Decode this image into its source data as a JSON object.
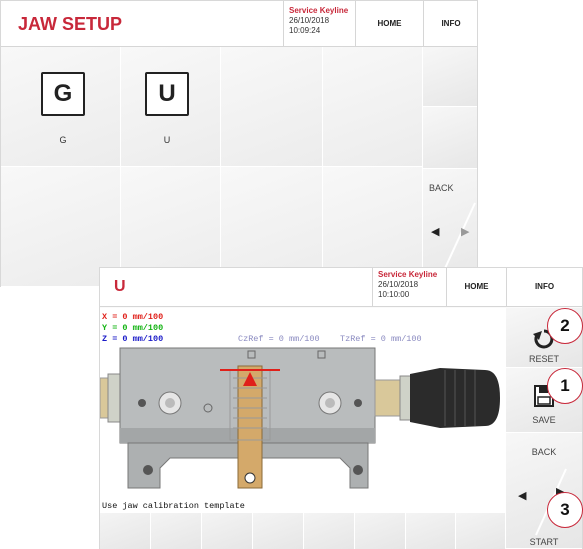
{
  "screen1": {
    "title": "JAW SETUP",
    "service": {
      "name": "Service Keyline",
      "date": "26/10/2018",
      "time": "10:09:24"
    },
    "home": "HOME",
    "info": "INFO",
    "jaws": [
      {
        "letter": "G",
        "label": "G"
      },
      {
        "letter": "U",
        "label": "U"
      }
    ],
    "back": "BACK"
  },
  "screen2": {
    "title": "U",
    "service": {
      "name": "Service Keyline",
      "date": "26/10/2018",
      "time": "10:10:00"
    },
    "home": "HOME",
    "info": "INFO",
    "coords": {
      "x": "X = 0 mm/100",
      "y": "Y = 0 mm/100",
      "z": "Z = 0 mm/100",
      "czref": "CzRef = 0 mm/100",
      "tzref": "TzRef = 0 mm/100"
    },
    "message": "Use jaw calibration template",
    "reset": "RESET",
    "save": "SAVE",
    "back": "BACK",
    "start": "START",
    "colors": {
      "x": "#e0201a",
      "y": "#12b312",
      "z": "#1a1ac8",
      "ref": "#8a8ac0"
    }
  },
  "callouts": [
    "2",
    "1",
    "3"
  ],
  "colors": {
    "accent": "#c8283a"
  }
}
